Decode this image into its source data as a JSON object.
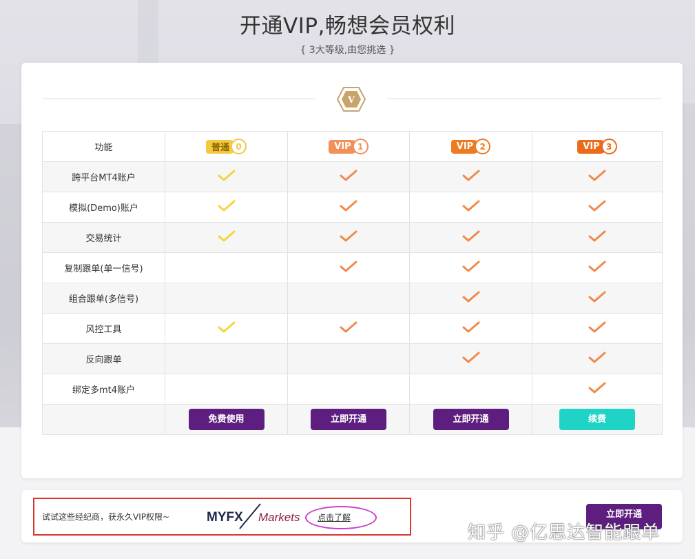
{
  "header": {
    "title": "开通VIP,畅想会员权利",
    "subtitle": "{ 3大等级,由您挑选 }"
  },
  "table": {
    "feature_header": "功能",
    "levels": [
      {
        "label": "普通",
        "num": "0",
        "color": "#f5c842",
        "text_color": "#8a6a00"
      },
      {
        "label": "VIP",
        "num": "1",
        "color": "#f2905a",
        "text_color": "#ffffff"
      },
      {
        "label": "VIP",
        "num": "2",
        "color": "#ee7a22",
        "text_color": "#ffffff"
      },
      {
        "label": "VIP",
        "num": "3",
        "color": "#ec6a1a",
        "text_color": "#ffffff"
      }
    ],
    "rows": [
      {
        "feature": "跨平台MT4账户",
        "checks": [
          true,
          true,
          true,
          true
        ]
      },
      {
        "feature": "模拟(Demo)账户",
        "checks": [
          true,
          true,
          true,
          true
        ]
      },
      {
        "feature": "交易统计",
        "checks": [
          true,
          true,
          true,
          true
        ]
      },
      {
        "feature": "复制跟单(单一信号)",
        "checks": [
          false,
          true,
          true,
          true
        ]
      },
      {
        "feature": "组合跟单(多信号)",
        "checks": [
          false,
          false,
          true,
          true
        ]
      },
      {
        "feature": "风控工具",
        "checks": [
          true,
          true,
          true,
          true
        ]
      },
      {
        "feature": "反向跟单",
        "checks": [
          false,
          false,
          true,
          true
        ]
      },
      {
        "feature": "绑定多mt4账户",
        "checks": [
          false,
          false,
          false,
          true
        ]
      }
    ],
    "buttons": [
      {
        "label": "免费使用",
        "color": "#5d1e7f"
      },
      {
        "label": "立即开通",
        "color": "#5d1e7f"
      },
      {
        "label": "立即开通",
        "color": "#5d1e7f"
      },
      {
        "label": "续费",
        "color": "#1fd3c6"
      }
    ],
    "check_colors": {
      "basic": "#f2d640",
      "vip": "#f08a4b"
    }
  },
  "promo": {
    "text": "试试这些经纪商，获永久VIP权限~",
    "logo_text_left": "MYFX",
    "logo_text_right": "Markets",
    "learn_more": "点击了解",
    "button": "立即开通"
  },
  "watermark": "知乎 @亿思达智能跟单"
}
